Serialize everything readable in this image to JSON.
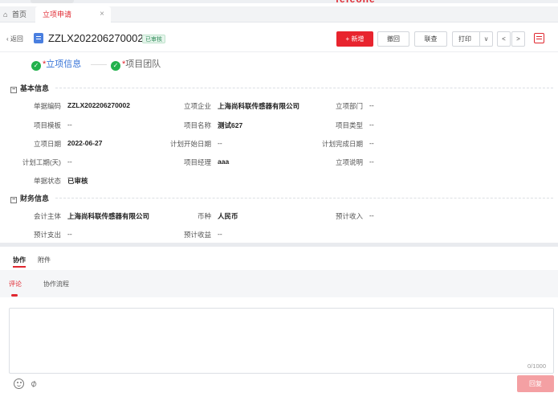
{
  "app": {
    "brand": "fefeone"
  },
  "tabs": {
    "home": "首页",
    "active": "立项申请",
    "close": "×"
  },
  "header": {
    "back": "返回",
    "title": "ZZLX202206270002",
    "status": "已审核",
    "buttons": {
      "add": "+ 新增",
      "withdraw": "撤回",
      "query": "联查",
      "print": "打印",
      "print_caret": "∨",
      "prev": "<",
      "next": ">"
    }
  },
  "steps": [
    {
      "star": "*",
      "label": "立项信息"
    },
    {
      "star": "*",
      "label": "项目团队"
    }
  ],
  "sections": {
    "basic": {
      "title": "基本信息",
      "collapse": "−",
      "fields": {
        "doc_no": {
          "label": "单据编码",
          "value": "ZZLX202206270002"
        },
        "company": {
          "label": "立项企业",
          "value": "上海尚科联传感器有限公司"
        },
        "dept": {
          "label": "立项部门",
          "value": "--"
        },
        "template": {
          "label": "项目模板",
          "value": "--"
        },
        "proj_name": {
          "label": "项目名称",
          "value": "测试627"
        },
        "proj_type": {
          "label": "项目类型",
          "value": "--"
        },
        "date": {
          "label": "立项日期",
          "value": "2022-06-27"
        },
        "plan_start": {
          "label": "计划开始日期",
          "value": "--"
        },
        "plan_end": {
          "label": "计划完成日期",
          "value": "--"
        },
        "plan_days": {
          "label": "计划工期(天)",
          "value": "--"
        },
        "manager": {
          "label": "项目经理",
          "value": "aaa"
        },
        "desc": {
          "label": "立项说明",
          "value": "--"
        },
        "doc_status": {
          "label": "单据状态",
          "value": "已审核"
        }
      }
    },
    "finance": {
      "title": "财务信息",
      "collapse": "−",
      "fields": {
        "entity": {
          "label": "会计主体",
          "value": "上海尚科联传感器有限公司"
        },
        "currency": {
          "label": "币种",
          "value": "人民币"
        },
        "income": {
          "label": "预计收入",
          "value": "--"
        },
        "expense": {
          "label": "预计支出",
          "value": "--"
        },
        "profit": {
          "label": "预计收益",
          "value": "--"
        }
      }
    }
  },
  "collab": {
    "tabs": [
      "协作",
      "附件"
    ],
    "panel_tabs": [
      "评论",
      "协作流程"
    ],
    "counter": "0/1000",
    "reply": "回复"
  }
}
